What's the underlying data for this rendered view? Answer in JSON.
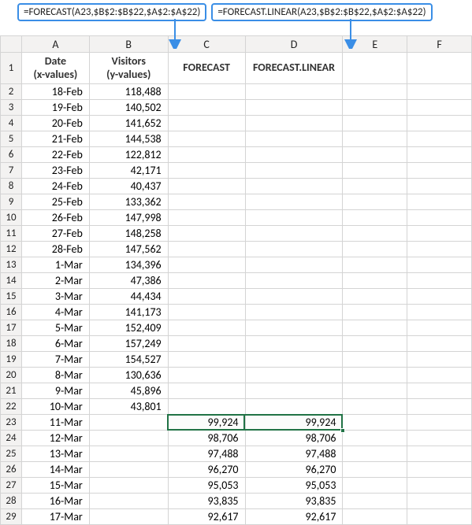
{
  "formulas": {
    "left": "=FORECAST(A23,$B$2:$B$22,$A$2:$A$22)",
    "right": "=FORECAST.LINEAR(A23,$B$2:$B$22,$A$2:$A$22)"
  },
  "columns": [
    "A",
    "B",
    "C",
    "D",
    "E",
    "F"
  ],
  "headers": {
    "A": "Date\n(x-values)",
    "B": "Visitors\n(y-values)",
    "C": "FORECAST",
    "D": "FORECAST.LINEAR"
  },
  "rows": [
    {
      "n": 2,
      "date": "18-Feb",
      "visitors": "118,488",
      "c": "",
      "d": ""
    },
    {
      "n": 3,
      "date": "19-Feb",
      "visitors": "140,502",
      "c": "",
      "d": ""
    },
    {
      "n": 4,
      "date": "20-Feb",
      "visitors": "141,652",
      "c": "",
      "d": ""
    },
    {
      "n": 5,
      "date": "21-Feb",
      "visitors": "144,538",
      "c": "",
      "d": ""
    },
    {
      "n": 6,
      "date": "22-Feb",
      "visitors": "122,812",
      "c": "",
      "d": ""
    },
    {
      "n": 7,
      "date": "23-Feb",
      "visitors": "42,171",
      "c": "",
      "d": ""
    },
    {
      "n": 8,
      "date": "24-Feb",
      "visitors": "40,437",
      "c": "",
      "d": ""
    },
    {
      "n": 9,
      "date": "25-Feb",
      "visitors": "133,362",
      "c": "",
      "d": ""
    },
    {
      "n": 10,
      "date": "26-Feb",
      "visitors": "147,998",
      "c": "",
      "d": ""
    },
    {
      "n": 11,
      "date": "27-Feb",
      "visitors": "148,258",
      "c": "",
      "d": ""
    },
    {
      "n": 12,
      "date": "28-Feb",
      "visitors": "147,562",
      "c": "",
      "d": ""
    },
    {
      "n": 13,
      "date": "1-Mar",
      "visitors": "134,396",
      "c": "",
      "d": ""
    },
    {
      "n": 14,
      "date": "2-Mar",
      "visitors": "47,386",
      "c": "",
      "d": ""
    },
    {
      "n": 15,
      "date": "3-Mar",
      "visitors": "44,434",
      "c": "",
      "d": ""
    },
    {
      "n": 16,
      "date": "4-Mar",
      "visitors": "141,173",
      "c": "",
      "d": ""
    },
    {
      "n": 17,
      "date": "5-Mar",
      "visitors": "152,409",
      "c": "",
      "d": ""
    },
    {
      "n": 18,
      "date": "6-Mar",
      "visitors": "157,249",
      "c": "",
      "d": ""
    },
    {
      "n": 19,
      "date": "7-Mar",
      "visitors": "154,527",
      "c": "",
      "d": ""
    },
    {
      "n": 20,
      "date": "8-Mar",
      "visitors": "130,636",
      "c": "",
      "d": ""
    },
    {
      "n": 21,
      "date": "9-Mar",
      "visitors": "45,896",
      "c": "",
      "d": ""
    },
    {
      "n": 22,
      "date": "10-Mar",
      "visitors": "43,801",
      "c": "",
      "d": ""
    },
    {
      "n": 23,
      "date": "11-Mar",
      "visitors": "",
      "c": "99,924",
      "d": "99,924"
    },
    {
      "n": 24,
      "date": "12-Mar",
      "visitors": "",
      "c": "98,706",
      "d": "98,706"
    },
    {
      "n": 25,
      "date": "13-Mar",
      "visitors": "",
      "c": "97,488",
      "d": "97,488"
    },
    {
      "n": 26,
      "date": "14-Mar",
      "visitors": "",
      "c": "96,270",
      "d": "96,270"
    },
    {
      "n": 27,
      "date": "15-Mar",
      "visitors": "",
      "c": "95,053",
      "d": "95,053"
    },
    {
      "n": 28,
      "date": "16-Mar",
      "visitors": "",
      "c": "93,835",
      "d": "93,835"
    },
    {
      "n": 29,
      "date": "17-Mar",
      "visitors": "",
      "c": "92,617",
      "d": "92,617"
    }
  ]
}
